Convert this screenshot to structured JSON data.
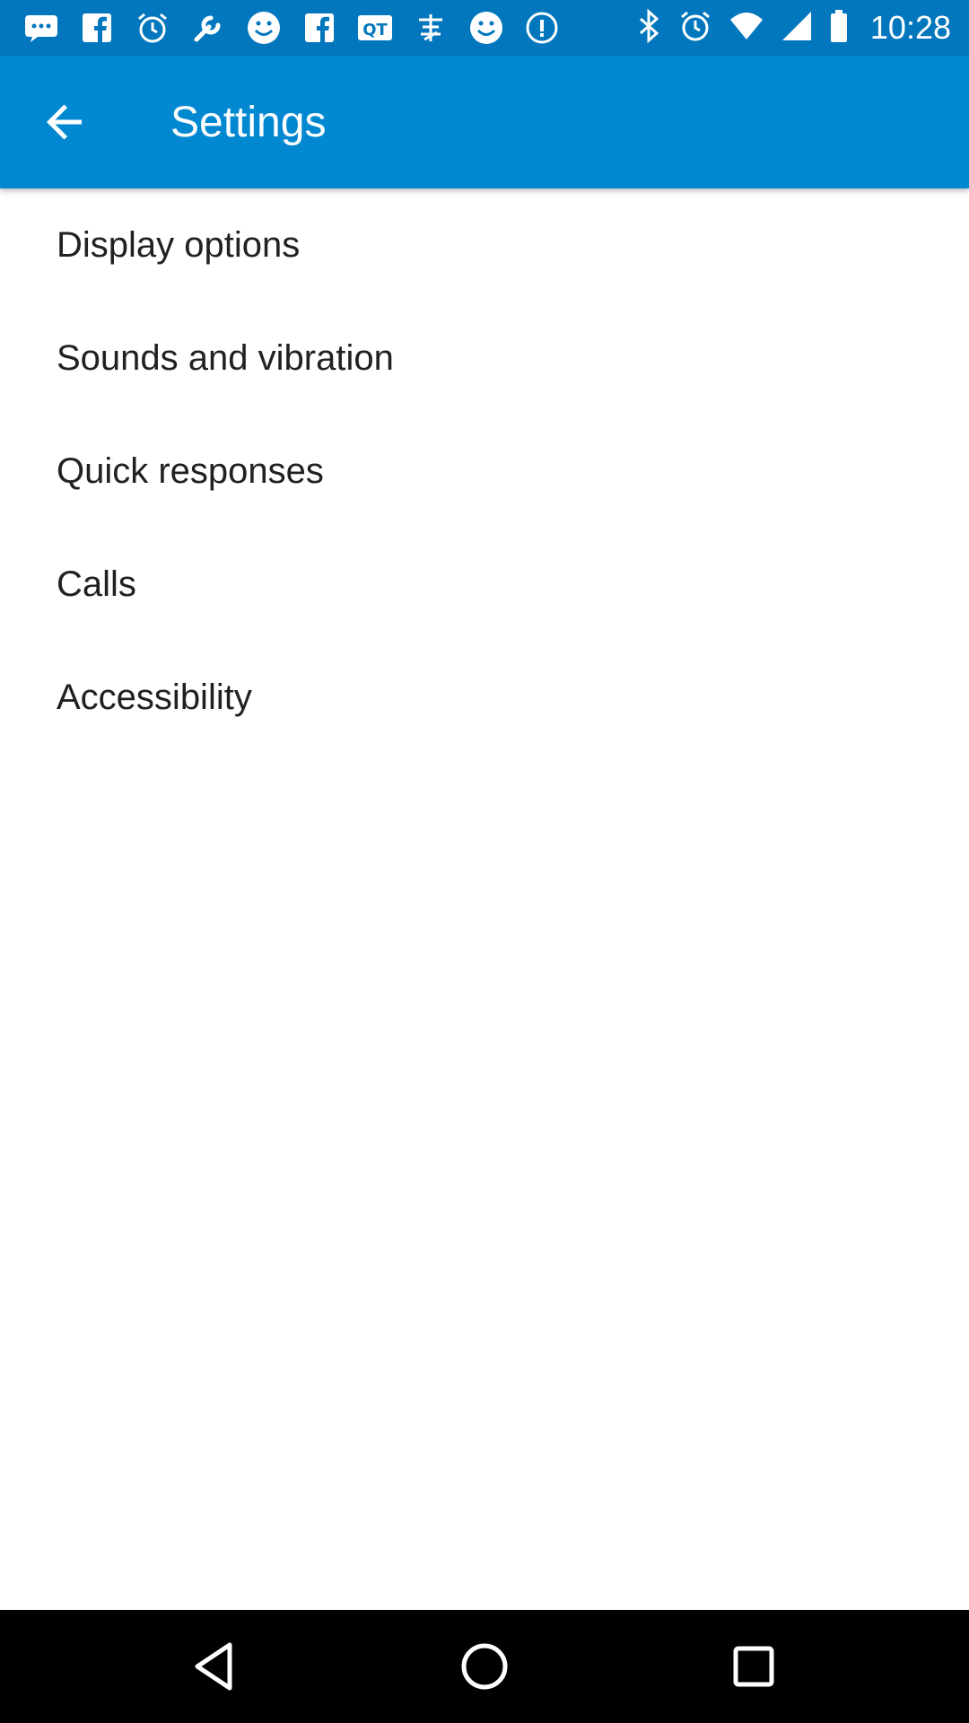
{
  "status_bar": {
    "time": "10:28",
    "left_icons": [
      "messages-icon",
      "facebook-icon",
      "alarm-icon",
      "wrench-icon",
      "smiley-icon",
      "facebook-icon",
      "qt-app-icon",
      "chinese-app-icon",
      "smiley-icon",
      "info-icon"
    ],
    "right_icons": [
      "bluetooth-icon",
      "alarm-icon",
      "wifi-icon",
      "cellular-signal-icon",
      "battery-icon"
    ]
  },
  "app_bar": {
    "title": "Settings",
    "back_icon": "back-arrow-icon",
    "color": "#0288d1"
  },
  "settings_list": [
    {
      "label": "Display options"
    },
    {
      "label": "Sounds and vibration"
    },
    {
      "label": "Quick responses"
    },
    {
      "label": "Calls"
    },
    {
      "label": "Accessibility"
    }
  ],
  "nav_bar": {
    "buttons": [
      "back-triangle-icon",
      "home-circle-icon",
      "recents-square-icon"
    ]
  }
}
